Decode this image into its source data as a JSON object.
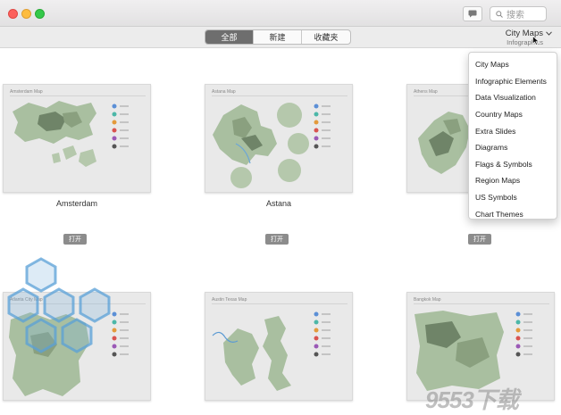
{
  "window": {
    "search_placeholder": "搜索"
  },
  "toolbar": {
    "tabs": [
      {
        "label": "全部",
        "active": true
      },
      {
        "label": "新建",
        "active": false
      },
      {
        "label": "收藏夹",
        "active": false
      }
    ],
    "category_selected": "City Maps",
    "category_subtitle": "Infographics"
  },
  "dropdown": {
    "items": [
      "City Maps",
      "Infographic Elements",
      "Data Visualization",
      "Country Maps",
      "Extra Slides",
      "Diagrams",
      "Flags & Symbols",
      "Region Maps",
      "US Symbols",
      "Chart Themes"
    ]
  },
  "cards": [
    {
      "thumb_title": "Amsterdam Map",
      "label": "Amsterdam",
      "button": "打开"
    },
    {
      "thumb_title": "Astana Map",
      "label": "Astana",
      "button": "打开"
    },
    {
      "thumb_title": "Athens Map",
      "label": "",
      "button": "打开"
    },
    {
      "thumb_title": "Atlanta City Map",
      "label": "",
      "button": ""
    },
    {
      "thumb_title": "Austin Texas Map",
      "label": "",
      "button": ""
    },
    {
      "thumb_title": "Bangkok Map",
      "label": "",
      "button": ""
    }
  ],
  "watermark": {
    "text": "9553下载"
  },
  "colors": {
    "map_fill": "#a9bfa0",
    "map_dark": "#6f8468",
    "pin_colors": [
      "#5b8fd6",
      "#4bb7a8",
      "#e39a3b",
      "#d9534f",
      "#9b59b6",
      "#555555"
    ]
  }
}
